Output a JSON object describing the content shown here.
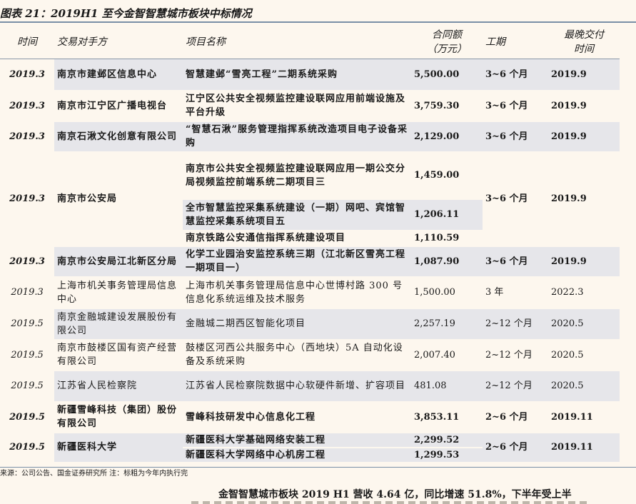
{
  "title": "图表 21：2019H1 至今金智智慧城市板块中标情况",
  "headers": {
    "time": "时间",
    "party": "交易对手方",
    "project": "项目名称",
    "amount_l1": "合同额",
    "amount_l2": "（万元）",
    "period": "工期",
    "delivery_l1": "最晚交付",
    "delivery_l2": "时间"
  },
  "rows": [
    {
      "year": "2019.3",
      "party": "南京市建邺区信息中心",
      "project": "智慧建邺“雪亮工程”二期系统采购",
      "amount": "5,500.00",
      "period": "3~6 个月",
      "delivery": "2019.9"
    },
    {
      "year": "2019.3",
      "party": "南京市江宁区广播电视台",
      "project": "江宁区公共安全视频监控建设联网应用前端设施及平台升级",
      "amount": "3,759.30",
      "period": "3~6 个月",
      "delivery": "2019.9"
    },
    {
      "year": "2019.3",
      "party": "南京石湫文化创意有限公司",
      "project": "“智慧石湫”服务管理指挥系统改造项目电子设备采购",
      "amount": "2,129.00",
      "period": "3~6 个月",
      "delivery": "2019.9"
    },
    {
      "year": "2019.3",
      "party": "南京市公安局",
      "period": "3~6 个月",
      "delivery": "2019.9",
      "subs": [
        {
          "project": "南京市公共安全视频监控建设联网应用一期公交分局视频监控前端系统二期项目三",
          "amount": "1,459.00"
        },
        {
          "project": "全市智慧监控采集系统建设（一期）网吧、宾馆智慧监控采集系统项目五",
          "amount": "1,206.11"
        },
        {
          "project": "南京铁路公安通信指挥系统建设项目",
          "amount": "1,110.59"
        }
      ]
    },
    {
      "year": "2019.3",
      "party": "南京市公安局江北新区分局",
      "project": "化学工业园治安监控系统三期（江北新区雪亮工程一期项目一）",
      "amount": "1,087.90",
      "period": "3~6 个月",
      "delivery": "2019.9"
    },
    {
      "year": "2019.3",
      "party": "上海市机关事务管理局信息中心",
      "project": "上海市机关事务管理局信息中心世博村路 300 号信息化系统运维及技术服务",
      "amount": "1,500.00",
      "period": "3 年",
      "delivery": "2022.3"
    },
    {
      "year": "2019.5",
      "party": "南京金融城建设发展股份有限公司",
      "project": "金融城二期西区智能化项目",
      "amount": "2,257.19",
      "period": "2~12 个月",
      "delivery": "2020.5"
    },
    {
      "year": "2019.5",
      "party": "南京市鼓楼区国有资产经营有限公司",
      "project": "鼓楼区河西公共服务中心（西地块）5A 自动化设备及系统采购",
      "amount": "2,007.40",
      "period": "2~12 个月",
      "delivery": "2020.5"
    },
    {
      "year": "2019.5",
      "party": "江苏省人民检察院",
      "project": "江苏省人民检察院数据中心软硬件新增、扩容项目",
      "amount": "481.08",
      "period": "2~12 个月",
      "delivery": "2020.5"
    },
    {
      "year": "2019.5",
      "party": "新疆雪峰科技（集团）股份有限公司",
      "project": "雪峰科技研发中心信息化工程",
      "amount": "3,853.11",
      "period": "2~6 个月",
      "delivery": "2019.11"
    },
    {
      "year": "2019.5",
      "party": "新疆医科大学",
      "period": "2~6 个月",
      "delivery": "2019.11",
      "subs": [
        {
          "project": "新疆医科大学基础网络安装工程",
          "amount": "2,299.52"
        },
        {
          "project": "新疆医科大学网络中心机房工程",
          "amount": "1,299.53"
        }
      ]
    }
  ],
  "footnote": "来源：公司公告、国金证券研究所 注：标粗为今年内执行完",
  "body_text": "金智智慧城市板块 2019 H1 营收 4.64 亿，同比增速 51.8%，下半年受上半"
}
